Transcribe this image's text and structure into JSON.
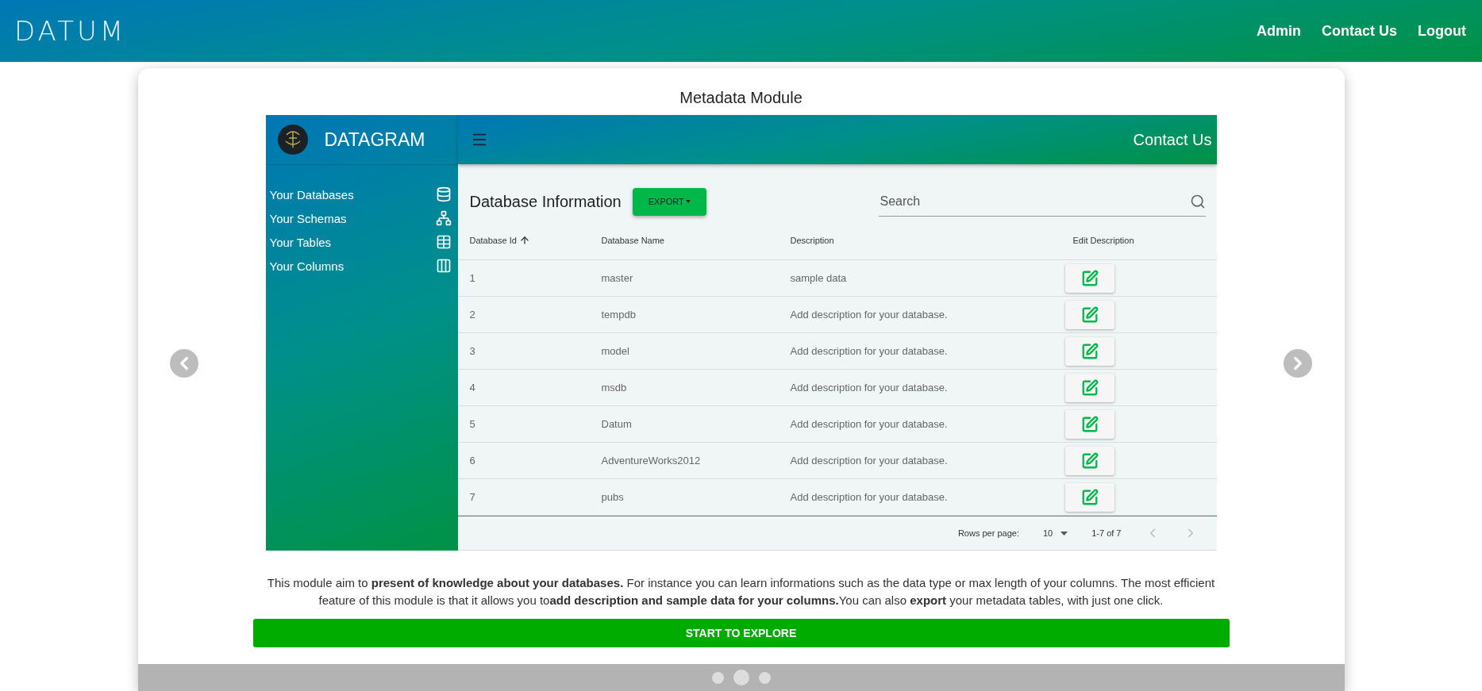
{
  "header": {
    "logo": "DATUM",
    "nav": [
      "Admin",
      "Contact Us",
      "Logout"
    ]
  },
  "card": {
    "title": "Metadata Module"
  },
  "preview": {
    "brand": "DATAGRAM",
    "contact": "Contact Us",
    "sidebar": [
      {
        "label": "Your Databases",
        "kind": "database"
      },
      {
        "label": "Your Schemas",
        "kind": "schema"
      },
      {
        "label": "Your Tables",
        "kind": "table"
      },
      {
        "label": "Your Columns",
        "kind": "columns"
      }
    ],
    "heading": "Database Information",
    "export": "EXPORT",
    "search": {
      "placeholder": "Search"
    },
    "columns": [
      {
        "label": "Database Id",
        "sorted": true
      },
      {
        "label": "Database Name",
        "sorted": false
      },
      {
        "label": "Description",
        "sorted": false
      },
      {
        "label": "Edit Description",
        "sorted": false
      }
    ],
    "rows": [
      {
        "id": "1",
        "name": "master",
        "description": "sample data"
      },
      {
        "id": "2",
        "name": "tempdb",
        "description": "Add description for your database."
      },
      {
        "id": "3",
        "name": "model",
        "description": "Add description for your database."
      },
      {
        "id": "4",
        "name": "msdb",
        "description": "Add description for your database."
      },
      {
        "id": "5",
        "name": "Datum",
        "description": "Add description for your database."
      },
      {
        "id": "6",
        "name": "AdventureWorks2012",
        "description": "Add description for your database."
      },
      {
        "id": "7",
        "name": "pubs",
        "description": "Add description for your database."
      }
    ],
    "pagination": {
      "rows_label": "Rows per page:",
      "rows_value": "10",
      "range": "1-7 of 7"
    }
  },
  "description": "This module aim to **present of knowledge about your databases.** For instance you can learn informations such as the data type or max length of your columns. The most efficient feature of this module is that it allows you to**add description and sample data for your columns.**You can also **export** your metadata tables, with just one click.",
  "cta": "START TO EXPLORE",
  "dots": [
    {
      "selected": false
    },
    {
      "selected": true
    },
    {
      "selected": false
    }
  ]
}
